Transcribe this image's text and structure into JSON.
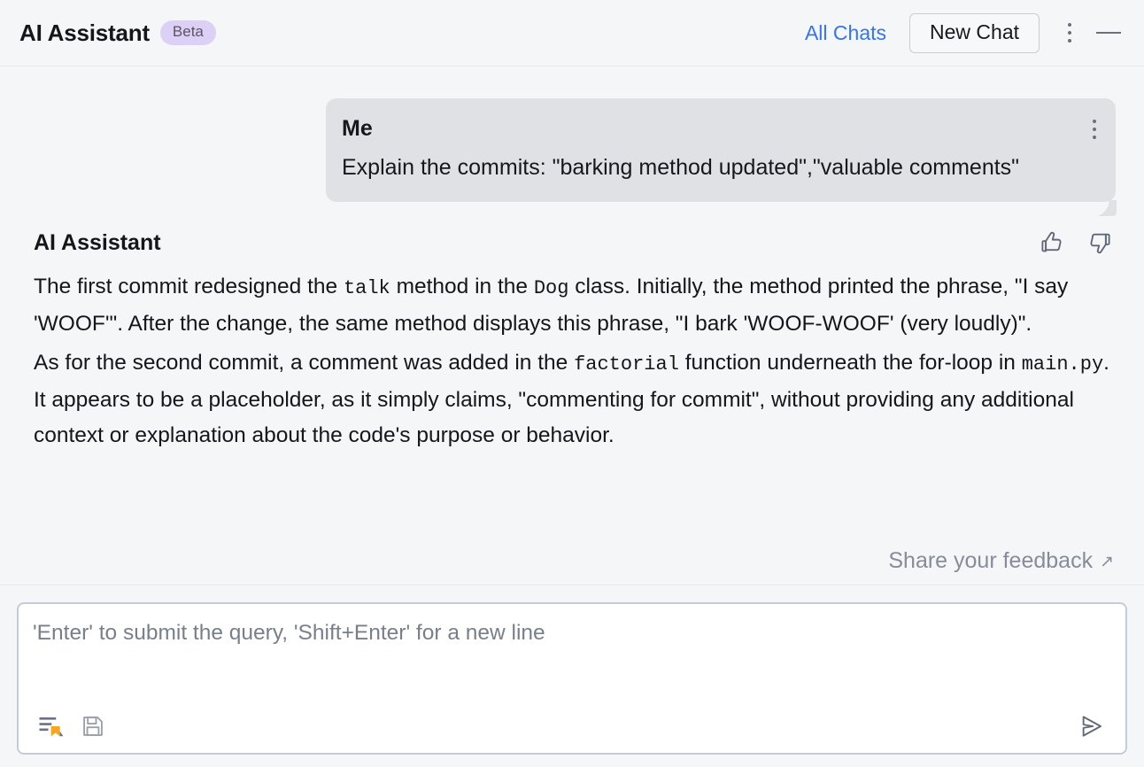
{
  "header": {
    "title": "AI Assistant",
    "badge": "Beta",
    "all_chats_label": "All Chats",
    "new_chat_label": "New Chat",
    "more_icon": "kebab-menu-icon",
    "minimize_icon": "minimize-icon",
    "accent_link_color": "#3574f0",
    "badge_bg_color": "#ddd0f7"
  },
  "conversation": {
    "user_message": {
      "author": "Me",
      "text": "Explain the commits: \"barking method updated\",\"valuable comments\"",
      "menu_icon": "kebab-menu-icon",
      "bubble_color": "#dfe1e5"
    },
    "assistant_message": {
      "author": "AI Assistant",
      "thumbs_up_icon": "thumbs-up-icon",
      "thumbs_down_icon": "thumbs-down-icon",
      "paragraph1": {
        "part1": "The first commit redesigned the ",
        "code1": "talk",
        "part2": " method in the ",
        "code2": "Dog",
        "part3": " class. Initially, the method printed the phrase, \"I say 'WOOF'\". After the change, the same method displays this phrase, \"I bark 'WOOF-WOOF' (very loudly)\"."
      },
      "paragraph2": {
        "part1": "As for the second commit, a comment was added in the ",
        "code1": "factorial",
        "part2": " function underneath the for-loop in ",
        "code2": "main.py",
        "part3": ". It appears to be a placeholder, as it simply claims, \"commenting for commit\", without providing any additional context or explanation about the code's purpose or behavior."
      }
    },
    "feedback": {
      "label": "Share your feedback",
      "arrow_icon": "external-link-arrow-icon"
    }
  },
  "composer": {
    "placeholder": "'Enter' to submit the query, 'Shift+Enter' for a new line",
    "value": "",
    "attach_context_icon": "attach-code-context-icon",
    "save_icon": "save-icon",
    "send_icon": "send-icon",
    "accent_orange": "#f9a825"
  }
}
